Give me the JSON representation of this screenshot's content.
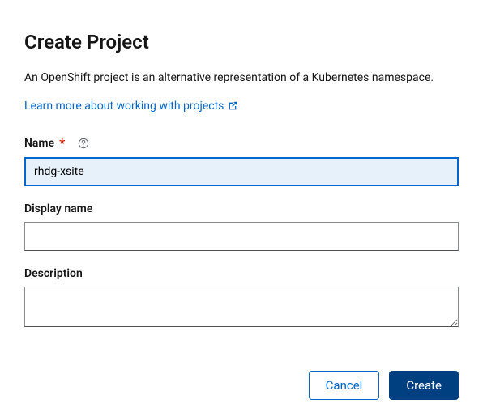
{
  "title": "Create Project",
  "description": "An OpenShift project is an alternative representation of a Kubernetes namespace.",
  "link_text": "Learn more about working with projects",
  "fields": {
    "name": {
      "label": "Name",
      "value": "rhdg-xsite"
    },
    "display_name": {
      "label": "Display name",
      "value": ""
    },
    "description": {
      "label": "Description",
      "value": ""
    }
  },
  "buttons": {
    "cancel": "Cancel",
    "create": "Create"
  }
}
